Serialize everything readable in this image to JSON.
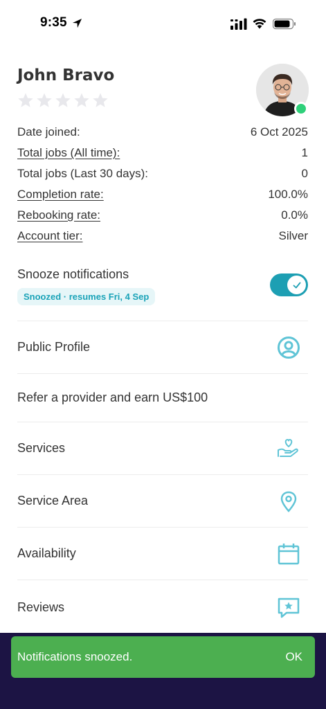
{
  "status_bar": {
    "time": "9:35"
  },
  "profile": {
    "name": "John Bravo",
    "rating_stars": 0,
    "star_count": 5
  },
  "stats": [
    {
      "label": "Date joined:",
      "value": "6 Oct 2025",
      "underlined": false
    },
    {
      "label": "Total jobs (All time):",
      "value": "1",
      "underlined": true
    },
    {
      "label": "Total jobs (Last 30 days):",
      "value": "0",
      "underlined": false
    },
    {
      "label": "Completion rate:",
      "value": "100.0%",
      "underlined": true
    },
    {
      "label": "Rebooking rate:",
      "value": "0.0%",
      "underlined": true
    },
    {
      "label": "Account tier:",
      "value": "Silver",
      "underlined": true
    }
  ],
  "snooze": {
    "label": "Snooze notifications",
    "badge": "Snoozed · resumes Fri, 4 Sep",
    "enabled": true
  },
  "menu": [
    {
      "label": "Public Profile",
      "icon": "user-circle-icon"
    },
    {
      "label": "Refer a provider and earn US$100",
      "icon": ""
    },
    {
      "label": "Services",
      "icon": "hand-heart-icon"
    },
    {
      "label": "Service Area",
      "icon": "map-pin-icon"
    },
    {
      "label": "Availability",
      "icon": "calendar-icon"
    },
    {
      "label": "Reviews",
      "icon": "star-message-icon"
    }
  ],
  "snackbar": {
    "message": "Notifications snoozed.",
    "action": "OK"
  },
  "colors": {
    "accent": "#1d9fb3",
    "icon": "#5fc4d6",
    "online": "#2fd07a",
    "snackbar": "#4caf50",
    "bottom_bar": "#1c1444"
  }
}
